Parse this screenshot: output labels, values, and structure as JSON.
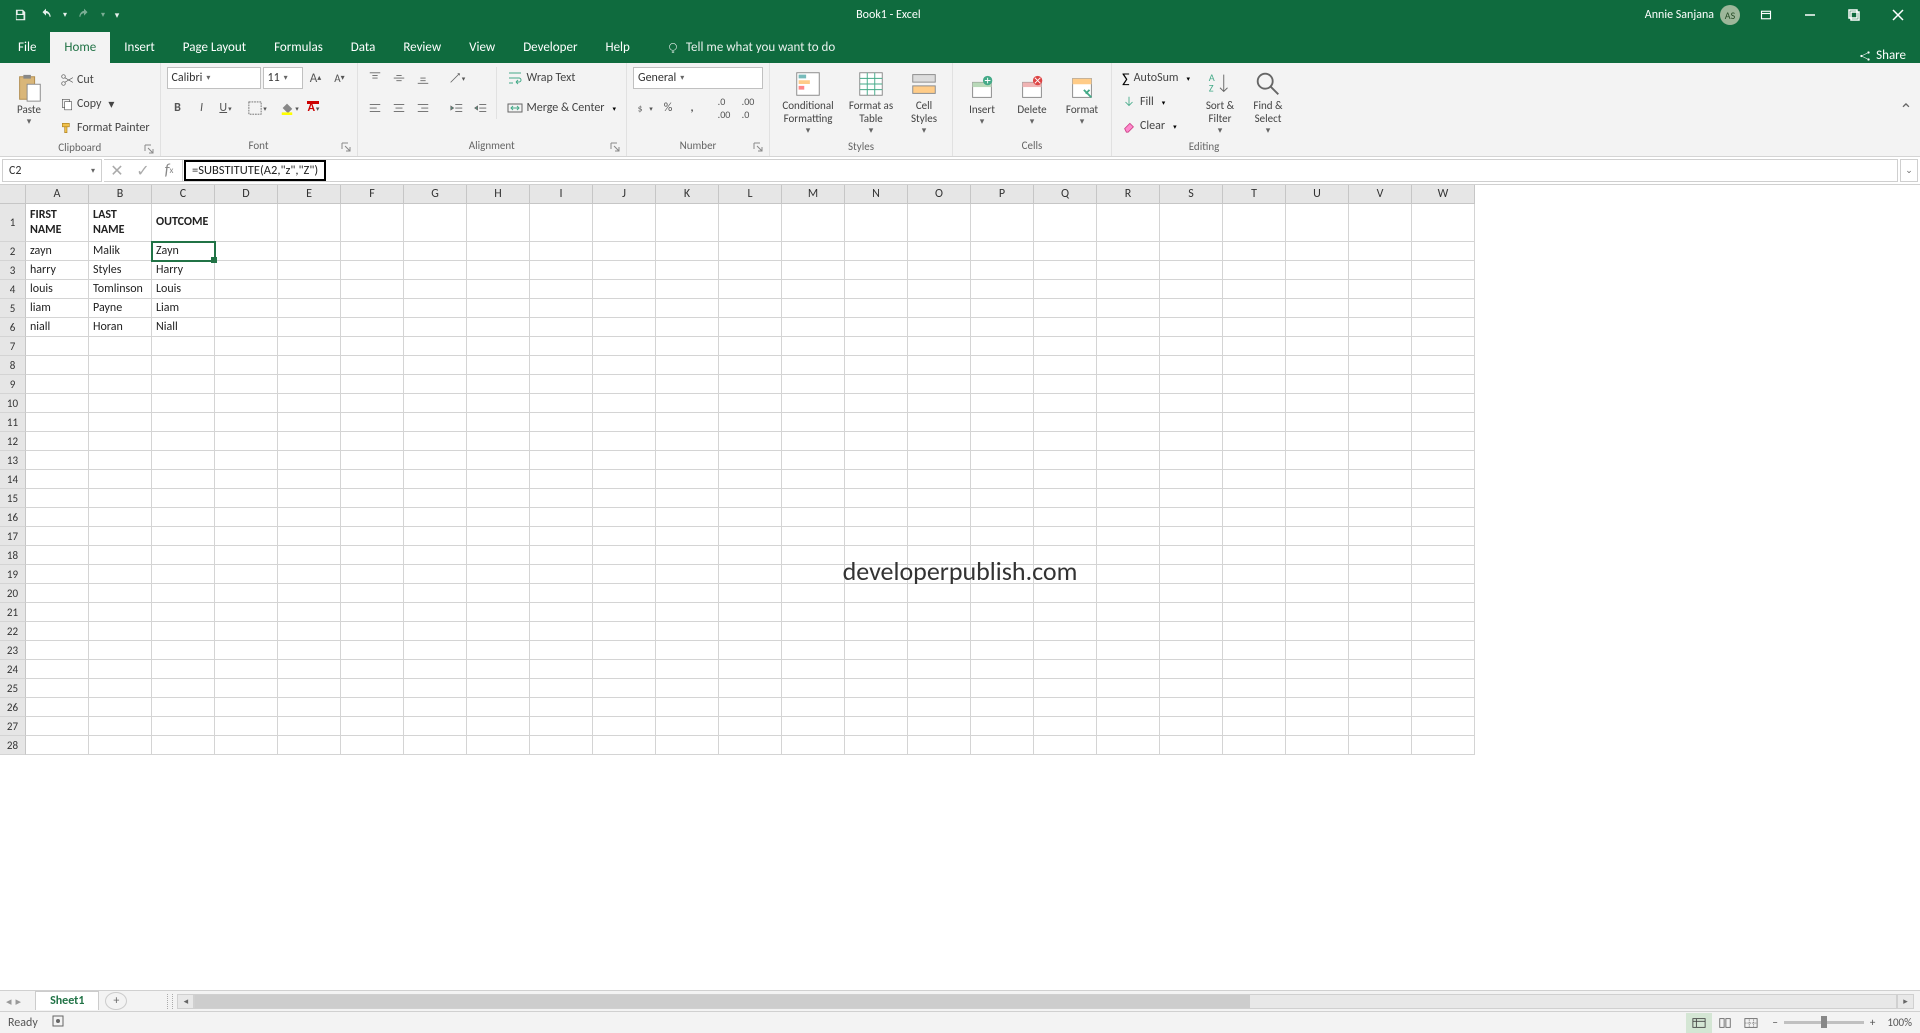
{
  "title": {
    "doc": "Book1",
    "app": "Excel"
  },
  "user": {
    "name": "Annie Sanjana",
    "initials": "AS"
  },
  "share_label": "Share",
  "tabs": [
    "File",
    "Home",
    "Insert",
    "Page Layout",
    "Formulas",
    "Data",
    "Review",
    "View",
    "Developer",
    "Help"
  ],
  "active_tab": "Home",
  "tellme": "Tell me what you want to do",
  "clipboard": {
    "group": "Clipboard",
    "paste": "Paste",
    "cut": "Cut",
    "copy": "Copy",
    "format_painter": "Format Painter"
  },
  "font": {
    "group": "Font",
    "name": "Calibri",
    "size": "11"
  },
  "alignment": {
    "group": "Alignment",
    "wrap": "Wrap Text",
    "merge": "Merge & Center"
  },
  "number": {
    "group": "Number",
    "format": "General"
  },
  "styles": {
    "group": "Styles",
    "conditional": "Conditional Formatting",
    "format_table": "Format as Table",
    "cell_styles": "Cell Styles"
  },
  "cells": {
    "group": "Cells",
    "insert": "Insert",
    "delete": "Delete",
    "format": "Format"
  },
  "editing": {
    "group": "Editing",
    "autosum": "AutoSum",
    "fill": "Fill",
    "clear": "Clear",
    "sort": "Sort & Filter",
    "find": "Find & Select"
  },
  "namebox": "C2",
  "formula": "=SUBSTITUTE(A2,\"z\",\"Z\")",
  "columns": [
    "A",
    "B",
    "C",
    "D",
    "E",
    "F",
    "G",
    "H",
    "I",
    "J",
    "K",
    "L",
    "M",
    "N",
    "O",
    "P",
    "Q",
    "R",
    "S",
    "T",
    "U",
    "V",
    "W"
  ],
  "rows": 28,
  "selected_cell": "C2",
  "sheet": {
    "name": "Sheet1",
    "data": {
      "A1": "FIRST NAME",
      "B1": "LAST NAME",
      "C1": "OUTCOME",
      "A2": "zayn",
      "B2": "Malik",
      "C2": "Zayn",
      "A3": "harry",
      "B3": "Styles",
      "C3": "Harry",
      "A4": "louis",
      "B4": "Tomlinson",
      "C4": "Louis",
      "A5": "liam",
      "B5": "Payne",
      "C5": "Liam",
      "A6": "niall",
      "B6": "Horan",
      "C6": "Niall"
    }
  },
  "watermark": "developerpublish.com",
  "status": {
    "ready": "Ready",
    "zoom": "100%"
  }
}
